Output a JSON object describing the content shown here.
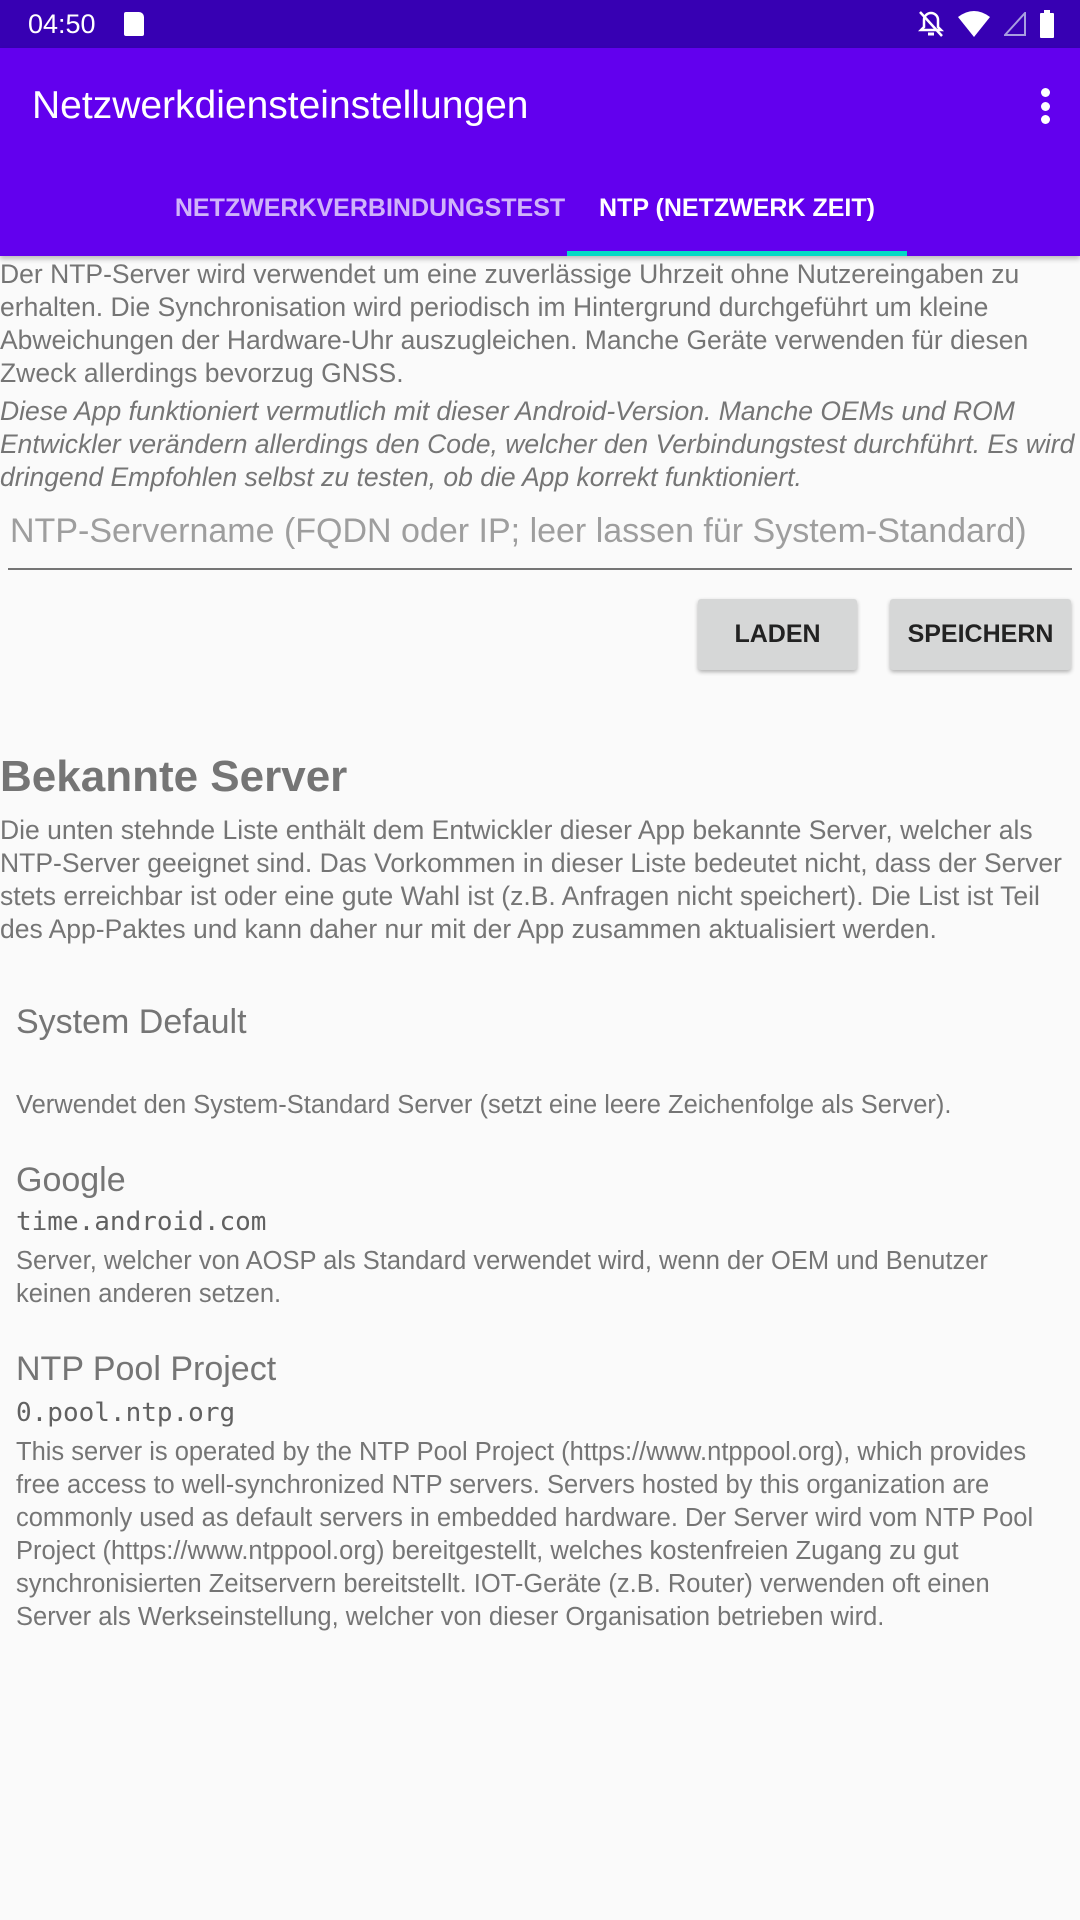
{
  "status_bar": {
    "time": "04:50",
    "icons": [
      "sd-card-icon",
      "notifications-off-icon",
      "wifi-icon",
      "cell-signal-icon",
      "battery-icon"
    ]
  },
  "app_bar": {
    "title": "Netzwerkdiensteinstellungen",
    "menu_icon": "more-vert-icon"
  },
  "tabs": [
    {
      "label": "NETZWERKVERBINDUNGSTEST",
      "selected": false
    },
    {
      "label": "NTP (NETZWERK ZEIT)",
      "selected": true
    }
  ],
  "intro": "Der NTP-Server wird verwendet um eine zuverlässige Uhrzeit ohne Nutzereingaben zu erhalten. Die Synchronisation wird periodisch im Hintergrund durchgeführt um kleine Abweichungen der Hardware-Uhr auszugleichen. Manche Geräte verwenden für diesen Zweck allerdings bevorzug GNSS.",
  "warning": "Diese App funktioniert vermutlich mit dieser Android-Version. Manche OEMs und ROM Entwickler verändern allerdings den Code, welcher den Verbindungstest durchführt. Es wird dringend Empfohlen selbst zu testen, ob die App korrekt funktioniert.",
  "server_input": {
    "value": "",
    "placeholder": "NTP-Servername (FQDN oder IP; leer lassen für System-Standard)"
  },
  "buttons": {
    "load": "LADEN",
    "save": "SPEICHERN"
  },
  "known": {
    "title": "Bekannte Server",
    "description": "Die unten stehnde Liste enthält dem Entwickler dieser App bekannte Server, welcher als NTP-Server geeignet sind. Das Vorkommen in dieser Liste bedeutet nicht, dass der Server stets erreichbar ist oder eine gute Wahl ist (z.B. Anfragen nicht speichert). Die List ist Teil des App-Paktes und kann daher nur mit der App zusammen aktualisiert werden.",
    "servers": [
      {
        "name": "System Default",
        "host": "",
        "description": "Verwendet den System-Standard Server (setzt eine leere Zeichenfolge als Server)."
      },
      {
        "name": "Google",
        "host": "time.android.com",
        "description": "Server, welcher von AOSP als Standard verwendet wird, wenn der OEM und Benutzer keinen anderen setzen."
      },
      {
        "name": "NTP Pool Project",
        "host": "0.pool.ntp.org",
        "description": "This server is operated by the NTP Pool Project (https://www.ntppool.org), which provides free access to well-synchronized NTP servers. Servers hosted by this organization are commonly used as default servers in embedded hardware. Der Server wird vom NTP Pool Project (https://www.ntppool.org) bereitgestellt, welches kostenfreien Zugang zu gut synchronisierten Zeitservern bereitstellt. IOT-Geräte (z.B. Router) verwenden oft einen Server als Werkseinstellung, welcher von dieser Organisation betrieben wird."
      }
    ]
  },
  "colors": {
    "status_bar": "#3700B3",
    "primary": "#6200EE",
    "accent": "#03DAC5",
    "background": "#FAFAFA"
  }
}
